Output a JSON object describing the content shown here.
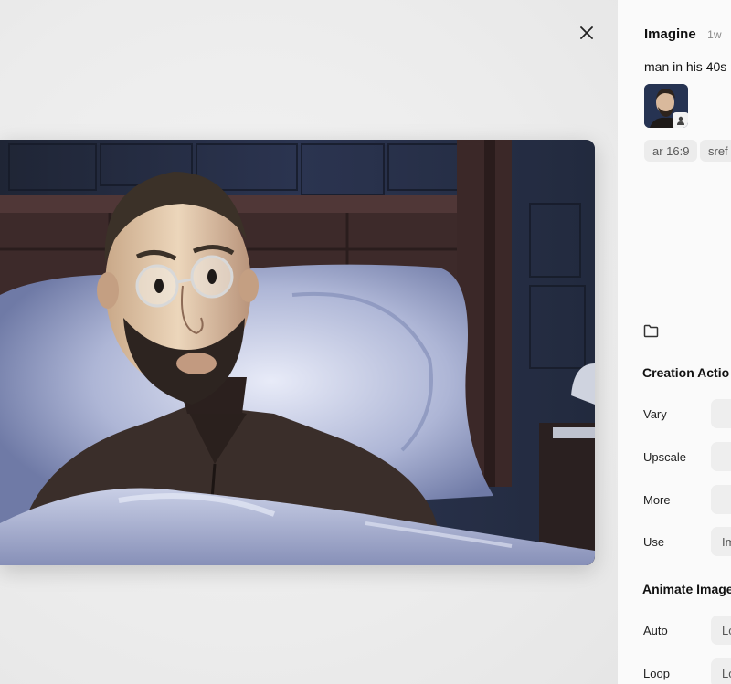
{
  "panel": {
    "title": "Imagine",
    "age": "1w",
    "prompt": "man in his 40s",
    "chips": [
      "ar 16:9",
      "sref"
    ],
    "creation_actions": {
      "heading": "Creation Actio",
      "rows": [
        {
          "label": "Vary",
          "value": ""
        },
        {
          "label": "Upscale",
          "value": ""
        },
        {
          "label": "More",
          "value": ""
        },
        {
          "label": "Use",
          "value": "Im"
        }
      ]
    },
    "animate": {
      "heading": "Animate Image",
      "rows": [
        {
          "label": "Auto",
          "value": "Lo"
        },
        {
          "label": "Loop",
          "value": "Lo"
        }
      ]
    }
  },
  "icons": {
    "close": "close-icon",
    "folder": "folder-icon",
    "user_badge": "person-icon"
  },
  "colors": {
    "panel_bg": "#fafafa",
    "chip_bg": "#ececec",
    "backdrop": "#efefef"
  }
}
